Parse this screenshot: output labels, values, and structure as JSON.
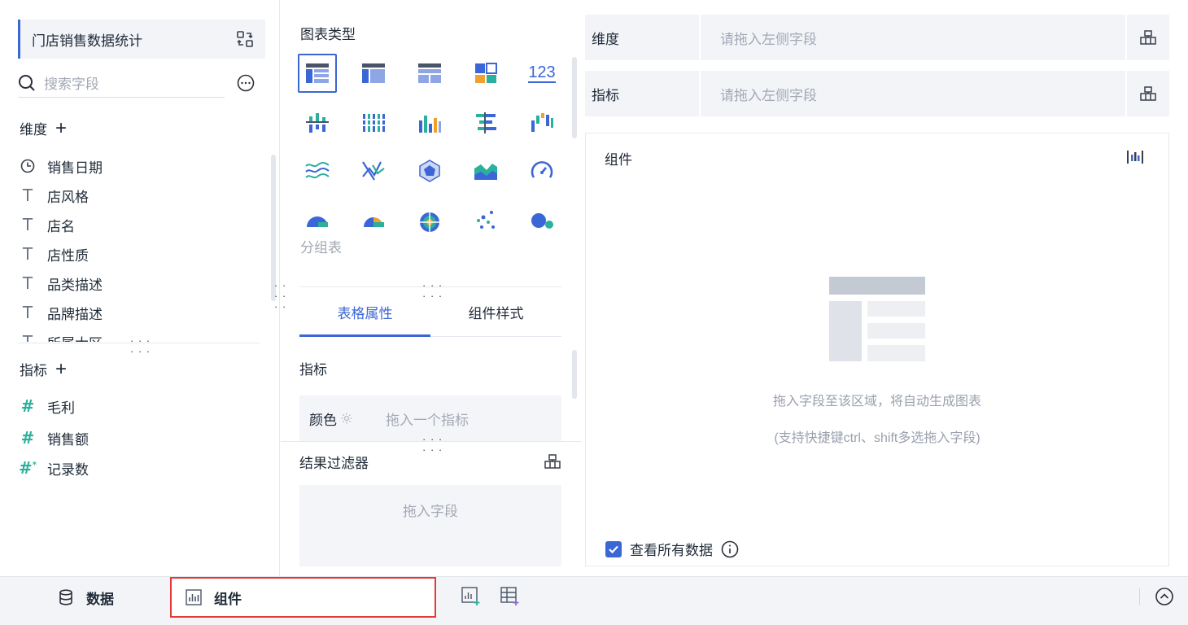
{
  "left": {
    "dataset_name": "门店销售数据统计",
    "search_placeholder": "搜索字段",
    "dimensions_title": "维度",
    "dimensions": [
      {
        "label": "销售日期",
        "icon": "clock-icon"
      },
      {
        "label": "店风格",
        "icon": "text-type-icon"
      },
      {
        "label": "店名",
        "icon": "text-type-icon"
      },
      {
        "label": "店性质",
        "icon": "text-type-icon"
      },
      {
        "label": "品类描述",
        "icon": "text-type-icon"
      },
      {
        "label": "品牌描述",
        "icon": "text-type-icon"
      },
      {
        "label": "所属大区",
        "icon": "text-type-icon"
      }
    ],
    "measures_title": "指标",
    "measures": [
      {
        "label": "毛利",
        "icon": "number-type-icon"
      },
      {
        "label": "销售额",
        "icon": "number-type-icon"
      },
      {
        "label": "记录数",
        "icon": "record-count-icon"
      }
    ]
  },
  "middle": {
    "chart_types_title": "图表类型",
    "selected_chart_caption": "分组表",
    "kpi_icon_text": "123",
    "tabs": [
      "表格属性",
      "组件样式"
    ],
    "active_tab": 0,
    "measure_section_title": "指标",
    "color_label": "颜色",
    "color_placeholder": "拖入一个指标",
    "filter_title": "结果过滤器",
    "filter_placeholder": "拖入字段"
  },
  "right": {
    "dimension_slot_label": "维度",
    "dimension_slot_placeholder": "请拖入左侧字段",
    "measure_slot_label": "指标",
    "measure_slot_placeholder": "请拖入左侧字段",
    "canvas_title": "组件",
    "empty_hint": "拖入字段至该区域，将自动生成图表",
    "empty_sub_hint": "(支持快捷键ctrl、shift多选拖入字段)",
    "view_all_label": "查看所有数据",
    "view_all_checked": true
  },
  "bottom": {
    "tabs": [
      {
        "label": "数据",
        "icon": "database-icon"
      },
      {
        "label": "组件",
        "icon": "chart-component-icon"
      }
    ],
    "active_tab": 1
  },
  "colors": {
    "accent": "#3b66d6",
    "teal": "#2bb09d",
    "highlight_border": "#e53935"
  }
}
